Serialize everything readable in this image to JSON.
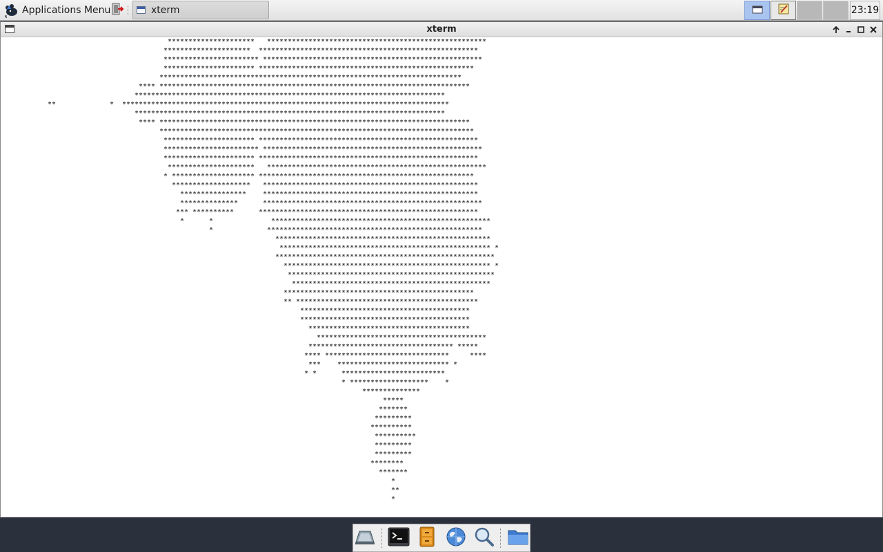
{
  "panel": {
    "app_menu_label": "Applications Menu",
    "task_title": "xterm",
    "clock": "23:19"
  },
  "window": {
    "title": "xterm"
  },
  "terminal": {
    "lines": [
      "                                        *********************   *****************************************************",
      "                                       *********************  *****************************************************",
      "                                       *********************** *****************************************************",
      "                                       ********************** ****************************************************",
      "                                      *************************************************************************",
      "                                 **** ***************************************************************************",
      "                                ***************************************************************************",
      "           **             *  *******************************************************************************",
      "                                ***************************************************************************",
      "                                 **** ***************************************************************************",
      "                                      ****************************************************************************",
      "                                       ********************** *****************************************************",
      "                                       *********************** *****************************************************",
      "                                       ********************** *****************************************************",
      "                                        *********************   *****************************************************",
      "                                       * ******************** ****************************************************",
      "                                         *******************   ****************************************************",
      "                                           ****************    ****************************************************",
      "                                           **************      *****************************************************",
      "                                          *** **********      *****************************************************",
      "                                           *      *              *****************************************************",
      "                                                  *             ****************************************************",
      "                                                                  ****************************************************",
      "                                                                   *************************************************** *",
      "                                                                  *****************************************************",
      "                                                                    ************************************************** *",
      "                                                                     **************************************************",
      "                                                                      ************************************************",
      "                                                                    **********************************************",
      "                                                                    ** ********************************************",
      "                                                                        *****************************************",
      "                                                                        *****************************************",
      "                                                                          ***************************************",
      "                                                                            *****************************************",
      "                                                                          *********************************** *****",
      "                                                                         **** ******************************     ****",
      "                                                                          ***    *************************** *",
      "                                                                         * *      *************************",
      "                                                                                  * *******************    *",
      "                                                                                       **************",
      "                                                                                            *****",
      "                                                                                           *******",
      "                                                                                          *********",
      "                                                                                         **********",
      "                                                                                          **********",
      "                                                                                          *********",
      "                                                                                          *********",
      "                                                                                         ********",
      "                                                                                           *******",
      "                                                                                              *",
      "                                                                                              **",
      "                                                                                              *"
    ]
  },
  "dock": {
    "items": [
      "show-desktop",
      "terminal",
      "file-manager",
      "web-browser",
      "app-finder",
      "folder"
    ]
  },
  "colors": {
    "desktop": "#2b303d",
    "terminal_bg": "#ffffff",
    "terminal_fg": "#000000",
    "active_workspace": "#a9c4ef"
  }
}
